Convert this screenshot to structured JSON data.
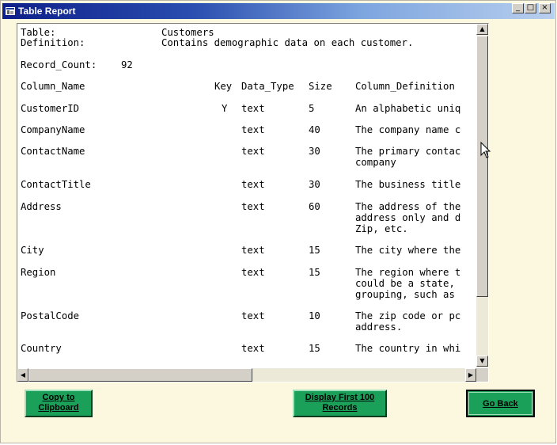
{
  "window": {
    "title": "Table Report",
    "controls": {
      "minimize": "_",
      "maximize": "□",
      "close": "×"
    }
  },
  "report": {
    "table_label": "Table:",
    "table_value": "Customers",
    "definition_label": "Definition:",
    "definition_value": "Contains demographic data on each customer.",
    "record_count_label": "Record_Count:",
    "record_count_value": "92",
    "headers": {
      "name": "Column_Name",
      "key": "Key",
      "type": "Data_Type",
      "size": "Size",
      "definition": "Column_Definition"
    },
    "rows": [
      {
        "name": "CustomerID",
        "key": "Y",
        "type": "text",
        "size": "5",
        "definition": [
          "An alphabetic uniq"
        ]
      },
      {
        "name": "CompanyName",
        "key": "",
        "type": "text",
        "size": "40",
        "definition": [
          "The company name c"
        ]
      },
      {
        "name": "ContactName",
        "key": "",
        "type": "text",
        "size": "30",
        "definition": [
          "The primary contac",
          "company"
        ]
      },
      {
        "name": "ContactTitle",
        "key": "",
        "type": "text",
        "size": "30",
        "definition": [
          "The business title"
        ]
      },
      {
        "name": "Address",
        "key": "",
        "type": "text",
        "size": "60",
        "definition": [
          "The address of the",
          "address only and d",
          "Zip, etc."
        ]
      },
      {
        "name": "City",
        "key": "",
        "type": "text",
        "size": "15",
        "definition": [
          "The city where the"
        ]
      },
      {
        "name": "Region",
        "key": "",
        "type": "text",
        "size": "15",
        "definition": [
          "The region where t",
          "could be a state,",
          "grouping, such as"
        ]
      },
      {
        "name": "PostalCode",
        "key": "",
        "type": "text",
        "size": "10",
        "definition": [
          "The zip code or pc",
          "address."
        ]
      },
      {
        "name": "Country",
        "key": "",
        "type": "text",
        "size": "15",
        "definition": [
          "The country in whi"
        ]
      }
    ]
  },
  "scrollbars": {
    "up": "▲",
    "down": "▼",
    "left": "◀",
    "right": "▶"
  },
  "buttons": {
    "copy": "Copy to Clipboard",
    "display": "Display First 100 Records",
    "back": "Go Back"
  },
  "colors": {
    "title_bar": "#0d1f8a",
    "window_bg": "#fcf8e0",
    "button_green": "#1ba05a"
  }
}
